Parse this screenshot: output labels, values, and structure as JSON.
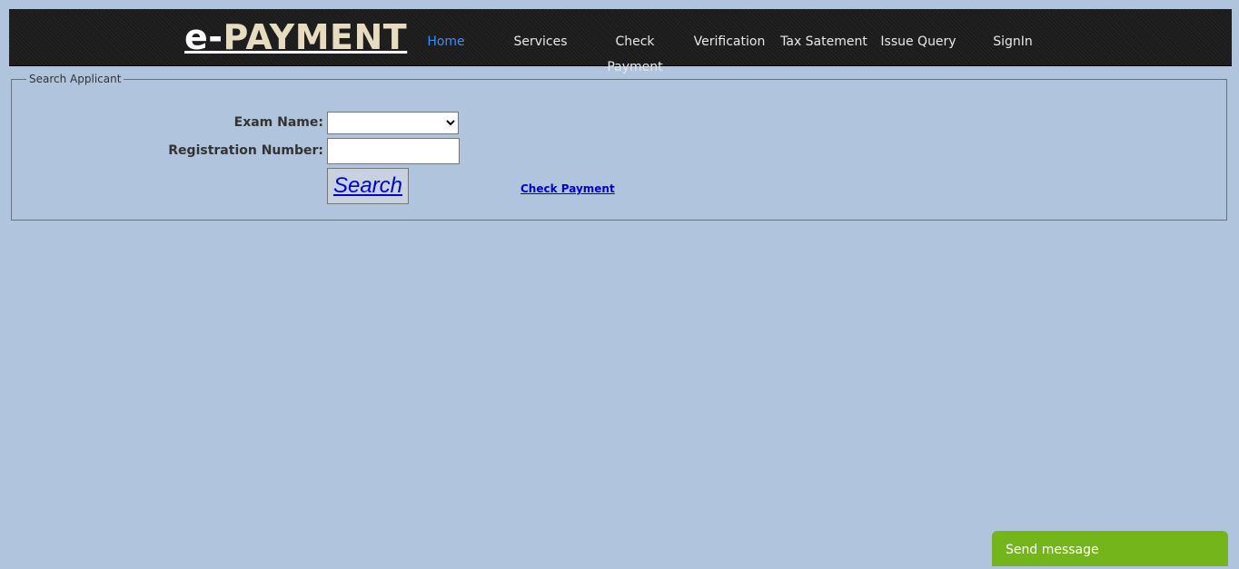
{
  "logo": {
    "prefix": "e-",
    "main": "PAYMENT"
  },
  "nav": {
    "items": [
      {
        "label": "Home",
        "active": true
      },
      {
        "label": "Services"
      },
      {
        "label": "Check Payment"
      },
      {
        "label": "Verification"
      },
      {
        "label": "Tax Satement"
      },
      {
        "label": "Issue Query"
      },
      {
        "label": "SignIn"
      }
    ]
  },
  "form": {
    "legend": "Search Applicant",
    "exam_label": "Exam Name:",
    "exam_value": "",
    "reg_label": "Registration Number:",
    "reg_value": "",
    "search_button": "Search",
    "check_payment_link": "Check Payment"
  },
  "chat": {
    "label": "Send message"
  },
  "colors": {
    "background": "#b0c4de",
    "header": "#1b1b1b",
    "nav_active": "#3d8ef5",
    "link": "#0000cc",
    "chat": "#75b51c"
  }
}
